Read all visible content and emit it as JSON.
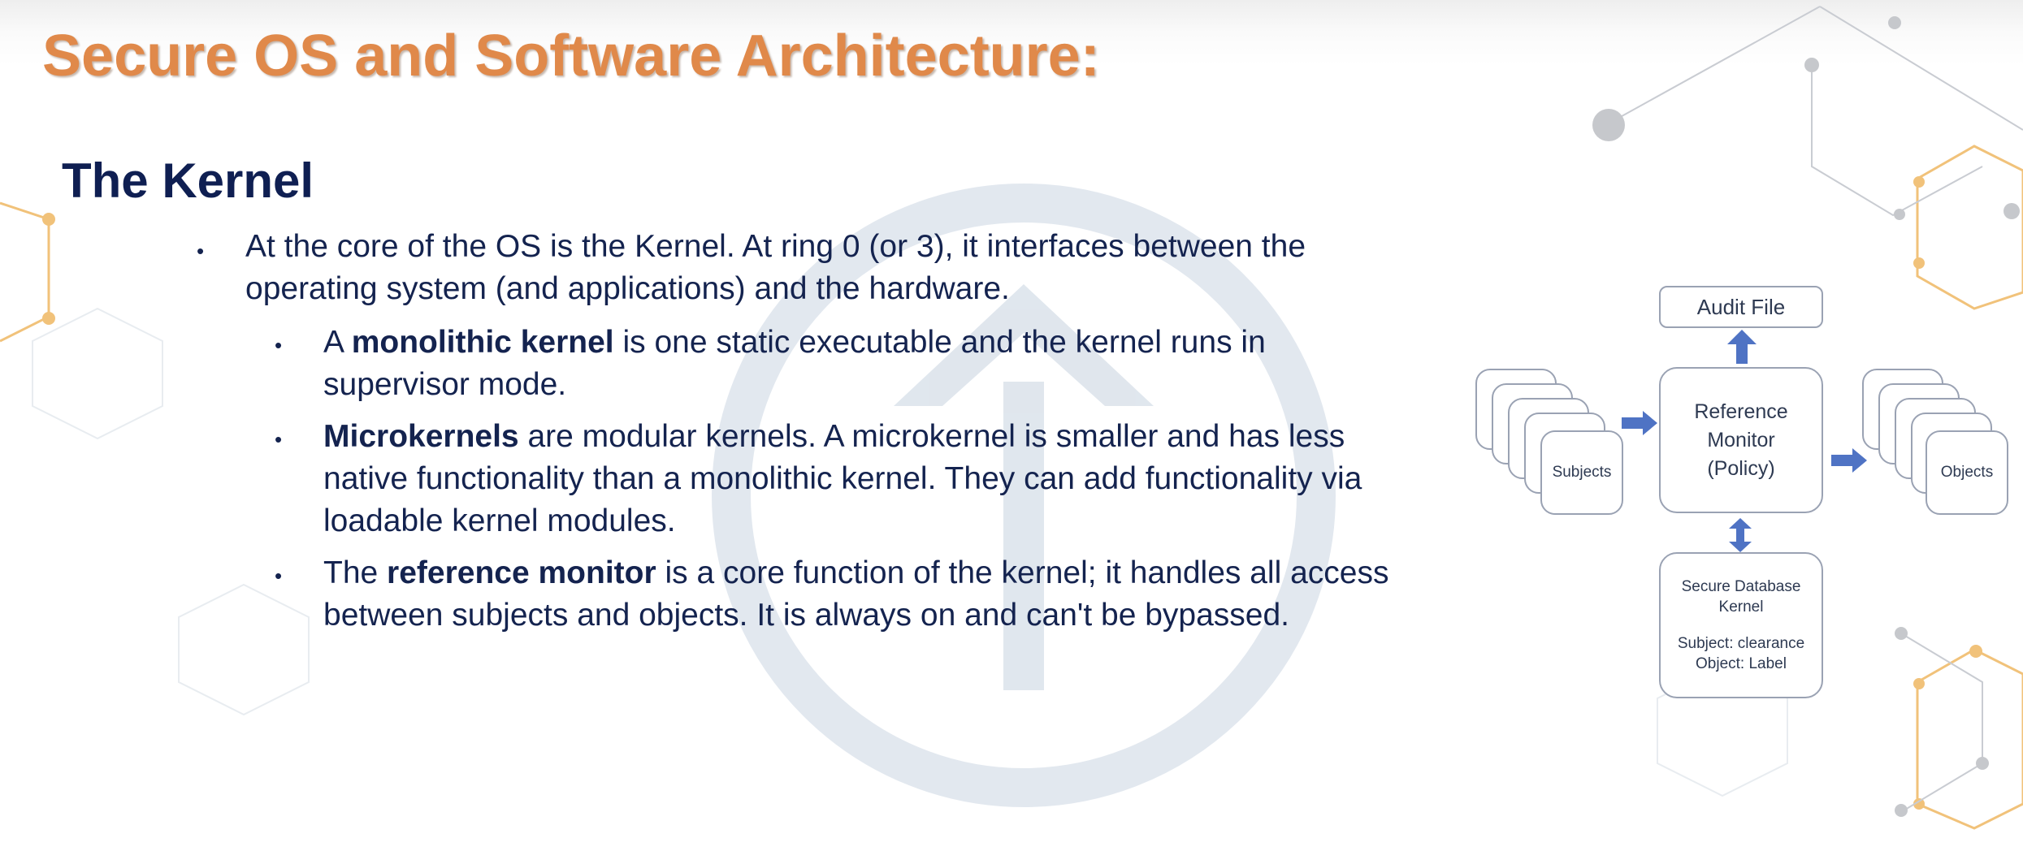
{
  "slide": {
    "title": "Secure OS and Software Architecture:",
    "subtitle": "The Kernel",
    "bullets": {
      "b1": "At the core of the OS is the Kernel. At ring 0 (or 3), it interfaces between the operating system (and applications) and the hardware.",
      "b2": {
        "pre": "A ",
        "bold": "monolithic kernel",
        "post": " is one static executable and the kernel runs in supervisor mode."
      },
      "b3": {
        "pre": "",
        "bold": "Microkernels",
        "post": " are modular kernels. A microkernel is smaller and has less native functionality than a monolithic kernel. They can add functionality via loadable kernel modules."
      },
      "b4": {
        "pre": "The ",
        "bold": "reference monitor",
        "post": " is a core function of the kernel; it handles all access between subjects and objects. It is always on and can't be bypassed."
      }
    }
  },
  "diagram": {
    "audit_file": "Audit File",
    "reference_monitor": [
      "Reference",
      "Monitor",
      "(Policy)"
    ],
    "subjects": "Subjects",
    "objects": "Objects",
    "secure_kernel": [
      "Secure Database",
      "Kernel"
    ],
    "kernel_subject": "Subject: clearance",
    "kernel_object": "Object: Label"
  },
  "colors": {
    "title": "#e0894a",
    "text": "#14234f",
    "arrow": "#4f73c4",
    "accent": "#e8b45a"
  }
}
